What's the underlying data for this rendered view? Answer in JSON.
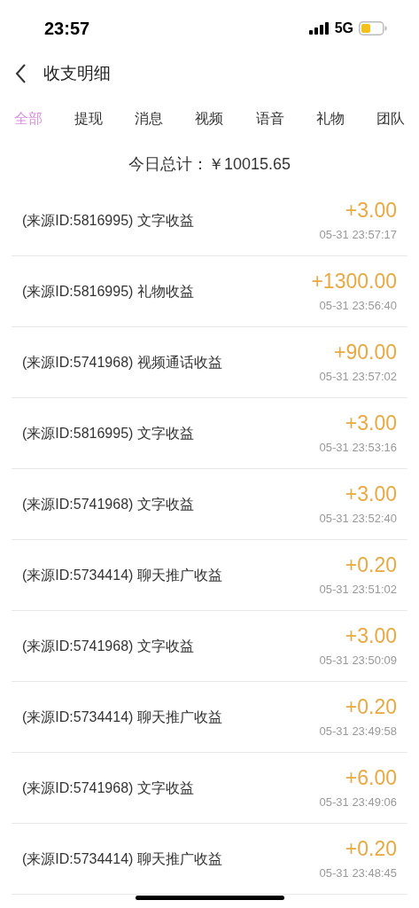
{
  "status_bar": {
    "time": "23:57",
    "network": "5G"
  },
  "header": {
    "title": "收支明细"
  },
  "tabs": [
    {
      "label": "全部",
      "selected": true
    },
    {
      "label": "提现",
      "selected": false
    },
    {
      "label": "消息",
      "selected": false
    },
    {
      "label": "视频",
      "selected": false
    },
    {
      "label": "语音",
      "selected": false
    },
    {
      "label": "礼物",
      "selected": false
    },
    {
      "label": "团队",
      "selected": false
    }
  ],
  "summary": {
    "text": "今日总计：￥10015.65"
  },
  "records": [
    {
      "description": "(来源ID:5816995) 文字收益",
      "amount": "+3.00",
      "time": "05-31 23:57:17"
    },
    {
      "description": "(来源ID:5816995) 礼物收益",
      "amount": "+1300.00",
      "time": "05-31 23:56:40"
    },
    {
      "description": "(来源ID:5741968) 视频通话收益",
      "amount": "+90.00",
      "time": "05-31 23:57:02"
    },
    {
      "description": "(来源ID:5816995) 文字收益",
      "amount": "+3.00",
      "time": "05-31 23:53:16"
    },
    {
      "description": "(来源ID:5741968) 文字收益",
      "amount": "+3.00",
      "time": "05-31 23:52:40"
    },
    {
      "description": "(来源ID:5734414) 聊天推广收益",
      "amount": "+0.20",
      "time": "05-31 23:51:02"
    },
    {
      "description": "(来源ID:5741968) 文字收益",
      "amount": "+3.00",
      "time": "05-31 23:50:09"
    },
    {
      "description": "(来源ID:5734414) 聊天推广收益",
      "amount": "+0.20",
      "time": "05-31 23:49:58"
    },
    {
      "description": "(来源ID:5741968) 文字收益",
      "amount": "+6.00",
      "time": "05-31 23:49:06"
    },
    {
      "description": "(来源ID:5734414) 聊天推广收益",
      "amount": "+0.20",
      "time": "05-31 23:48:45"
    }
  ]
}
